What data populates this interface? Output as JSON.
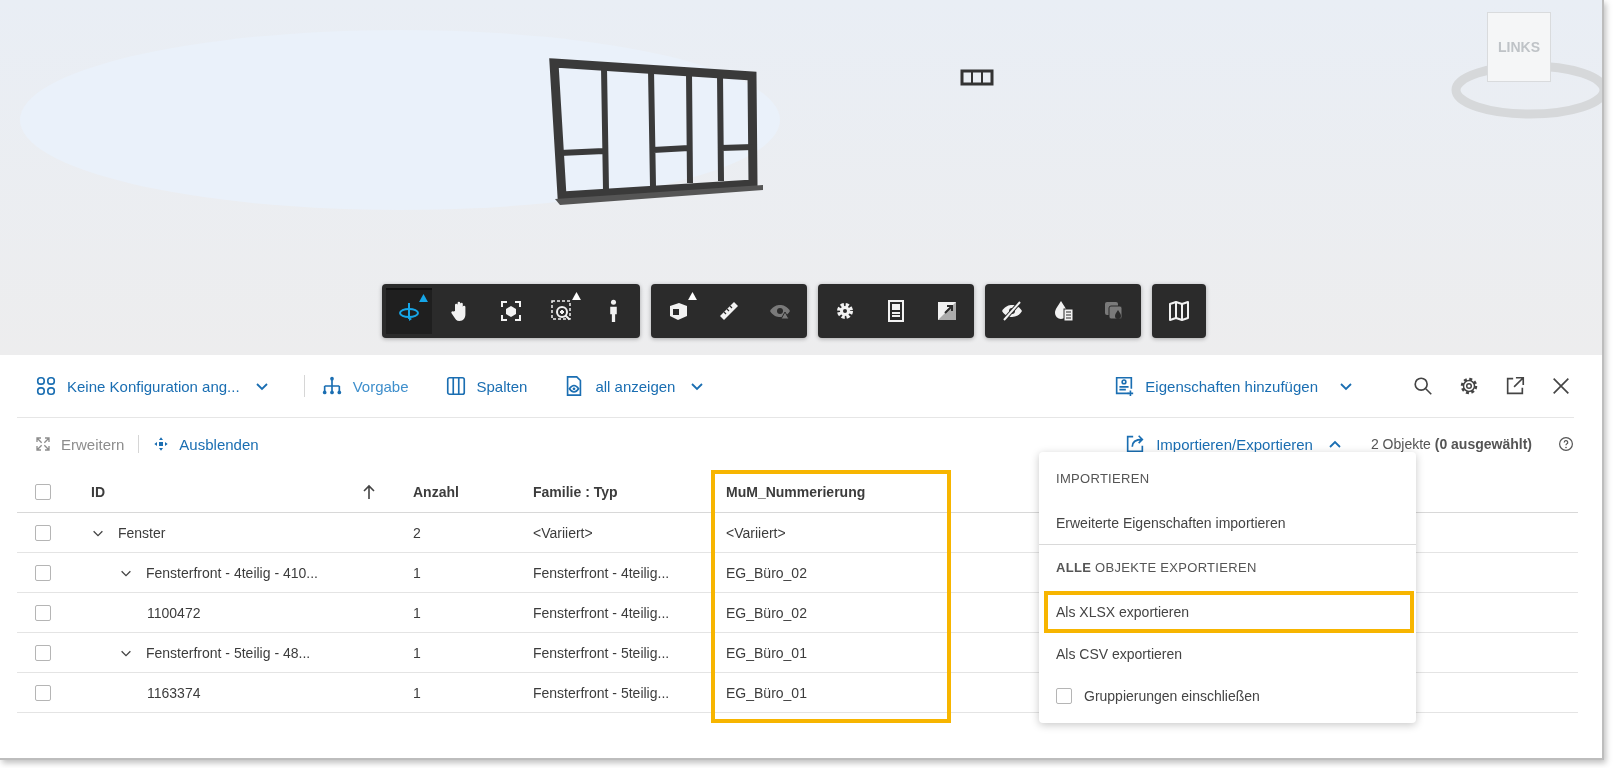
{
  "viewer": {
    "viewcube_label": "LINKS",
    "toolbar": [
      {
        "tools": [
          {
            "selected": true,
            "flyout": true,
            "disabled": false
          },
          {
            "selected": false,
            "flyout": false,
            "disabled": false
          },
          {
            "selected": false,
            "flyout": false,
            "disabled": false
          },
          {
            "selected": false,
            "flyout": true,
            "disabled": false
          },
          {
            "selected": false,
            "flyout": false,
            "disabled": false
          }
        ]
      },
      {
        "tools": [
          {
            "selected": false,
            "flyout": true,
            "disabled": false
          },
          {
            "selected": false,
            "flyout": false,
            "disabled": false
          },
          {
            "selected": false,
            "flyout": false,
            "disabled": true
          }
        ]
      },
      {
        "tools": [
          {
            "selected": false,
            "flyout": false,
            "disabled": false
          },
          {
            "selected": false,
            "flyout": false,
            "disabled": false
          },
          {
            "selected": false,
            "flyout": false,
            "disabled": false
          }
        ]
      },
      {
        "tools": [
          {
            "selected": false,
            "flyout": false,
            "disabled": false
          },
          {
            "selected": false,
            "flyout": false,
            "disabled": false
          },
          {
            "selected": false,
            "flyout": false,
            "disabled": true
          }
        ]
      },
      {
        "tools": [
          {
            "selected": false,
            "flyout": false,
            "disabled": false
          }
        ]
      }
    ]
  },
  "top_bar": {
    "configuration": "Keine Konfiguration ang...",
    "grouping": "Vorgabe",
    "columns": "Spalten",
    "visibility": "all anzeigen",
    "add_properties": "Eigenschaften hinzufügen"
  },
  "action_bar": {
    "expand": {
      "label": "Erweitern",
      "disabled": true
    },
    "collapse": {
      "label": "Ausblenden",
      "disabled": false
    },
    "import_export": {
      "label": "Importieren/Exportieren",
      "expanded": true
    },
    "count": "2 Objekte **(0 ausgewählt)**"
  },
  "table": {
    "select_all_checked": false,
    "columns": [
      {
        "label": "ID",
        "sorted": true,
        "highlighted": false
      },
      {
        "label": "Anzahl",
        "sorted": false,
        "highlighted": false
      },
      {
        "label": "Familie : Typ",
        "sorted": false,
        "highlighted": false
      },
      {
        "label": "MuM_Nummerierung",
        "sorted": false,
        "highlighted": true
      }
    ],
    "rows": [
      {
        "id": "Fenster",
        "count": "2",
        "family_type": "<Variiert>",
        "numbering": "<Variiert>",
        "checked": false,
        "expanded": true,
        "children": [
          {
            "id": "Fensterfront - 4teilig - 410...",
            "count": "1",
            "family_type": "Fensterfront - 4teilig...",
            "numbering": "EG_Büro_02",
            "checked": false,
            "expanded": true,
            "children": [
              {
                "id": "1100472",
                "count": "1",
                "family_type": "Fensterfront - 4teilig...",
                "numbering": "EG_Büro_02",
                "checked": false
              }
            ]
          },
          {
            "id": "Fensterfront - 5teilig - 48...",
            "count": "1",
            "family_type": "Fensterfront - 5teilig...",
            "numbering": "EG_Büro_01",
            "checked": false,
            "expanded": true,
            "children": [
              {
                "id": "1163374",
                "count": "1",
                "family_type": "Fensterfront - 5teilig...",
                "numbering": "EG_Büro_01",
                "checked": false
              }
            ]
          }
        ]
      }
    ]
  },
  "menu": {
    "items": [
      {
        "kind": "header",
        "text": "IMPORTIEREN"
      },
      {
        "kind": "item",
        "text": "Erweiterte Eigenschaften importieren",
        "highlighted": false
      },
      {
        "kind": "divider"
      },
      {
        "kind": "header",
        "text": "**ALLE** OBJEKTE EXPORTIEREN"
      },
      {
        "kind": "item",
        "text": "Als XLSX exportieren",
        "highlighted": true
      },
      {
        "kind": "item",
        "text": "Als CSV exportieren",
        "highlighted": false
      },
      {
        "kind": "checkbox",
        "text": "Gruppierungen einschließen",
        "checked": false
      }
    ]
  }
}
